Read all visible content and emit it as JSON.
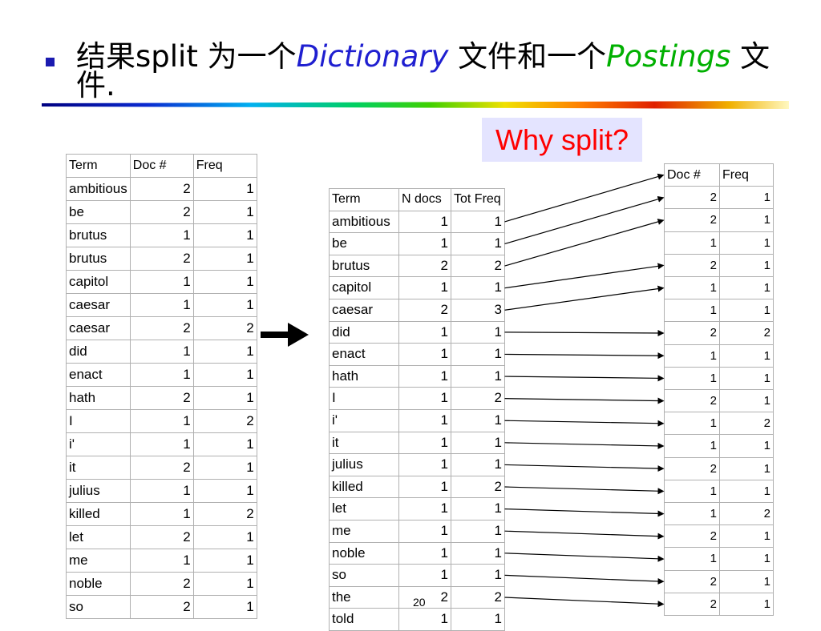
{
  "title": {
    "prefix": "结果split 为一个",
    "dict": "Dictionary",
    "middle": " 文件和一个",
    "postings": "Postings",
    "suffix": " 文件."
  },
  "colors": {
    "dictionary": "#1f1fd0",
    "postings": "#00b000",
    "why_text": "#ff0000",
    "why_bg": "#e4e4ff"
  },
  "why_label": "Why split?",
  "page_number": "20",
  "left_table": {
    "headers": [
      "Term",
      "Doc #",
      "Freq"
    ],
    "rows": [
      [
        "ambitious",
        "2",
        "1"
      ],
      [
        "be",
        "2",
        "1"
      ],
      [
        "brutus",
        "1",
        "1"
      ],
      [
        "brutus",
        "2",
        "1"
      ],
      [
        "capitol",
        "1",
        "1"
      ],
      [
        "caesar",
        "1",
        "1"
      ],
      [
        "caesar",
        "2",
        "2"
      ],
      [
        "did",
        "1",
        "1"
      ],
      [
        "enact",
        "1",
        "1"
      ],
      [
        "hath",
        "2",
        "1"
      ],
      [
        "I",
        "1",
        "2"
      ],
      [
        "i'",
        "1",
        "1"
      ],
      [
        "it",
        "2",
        "1"
      ],
      [
        "julius",
        "1",
        "1"
      ],
      [
        "killed",
        "1",
        "2"
      ],
      [
        "let",
        "2",
        "1"
      ],
      [
        "me",
        "1",
        "1"
      ],
      [
        "noble",
        "2",
        "1"
      ],
      [
        "so",
        "2",
        "1"
      ]
    ]
  },
  "dict_table": {
    "headers": [
      "Term",
      "N docs",
      "Tot Freq"
    ],
    "rows": [
      [
        "ambitious",
        "1",
        "1"
      ],
      [
        "be",
        "1",
        "1"
      ],
      [
        "brutus",
        "2",
        "2"
      ],
      [
        "capitol",
        "1",
        "1"
      ],
      [
        "caesar",
        "2",
        "3"
      ],
      [
        "did",
        "1",
        "1"
      ],
      [
        "enact",
        "1",
        "1"
      ],
      [
        "hath",
        "1",
        "1"
      ],
      [
        "I",
        "1",
        "2"
      ],
      [
        "i'",
        "1",
        "1"
      ],
      [
        "it",
        "1",
        "1"
      ],
      [
        "julius",
        "1",
        "1"
      ],
      [
        "killed",
        "1",
        "2"
      ],
      [
        "let",
        "1",
        "1"
      ],
      [
        "me",
        "1",
        "1"
      ],
      [
        "noble",
        "1",
        "1"
      ],
      [
        "so",
        "1",
        "1"
      ],
      [
        "the",
        "2",
        "2"
      ],
      [
        "told",
        "1",
        "1"
      ]
    ]
  },
  "postings_table": {
    "headers": [
      "Doc #",
      "Freq"
    ],
    "rows": [
      [
        "2",
        "1"
      ],
      [
        "2",
        "1"
      ],
      [
        "1",
        "1"
      ],
      [
        "2",
        "1"
      ],
      [
        "1",
        "1"
      ],
      [
        "1",
        "1"
      ],
      [
        "2",
        "2"
      ],
      [
        "1",
        "1"
      ],
      [
        "1",
        "1"
      ],
      [
        "2",
        "1"
      ],
      [
        "1",
        "2"
      ],
      [
        "1",
        "1"
      ],
      [
        "2",
        "1"
      ],
      [
        "1",
        "1"
      ],
      [
        "1",
        "2"
      ],
      [
        "2",
        "1"
      ],
      [
        "1",
        "1"
      ],
      [
        "2",
        "1"
      ],
      [
        "2",
        "1"
      ]
    ]
  },
  "pointer_links": [
    [
      0,
      0
    ],
    [
      1,
      1
    ],
    [
      2,
      2
    ],
    [
      3,
      4
    ],
    [
      4,
      5
    ],
    [
      5,
      7
    ],
    [
      6,
      8
    ],
    [
      7,
      9
    ],
    [
      8,
      10
    ],
    [
      9,
      11
    ],
    [
      10,
      12
    ],
    [
      11,
      13
    ],
    [
      12,
      14
    ],
    [
      13,
      15
    ],
    [
      14,
      16
    ],
    [
      15,
      17
    ],
    [
      16,
      18
    ],
    [
      17,
      19
    ],
    [
      18,
      20
    ]
  ]
}
